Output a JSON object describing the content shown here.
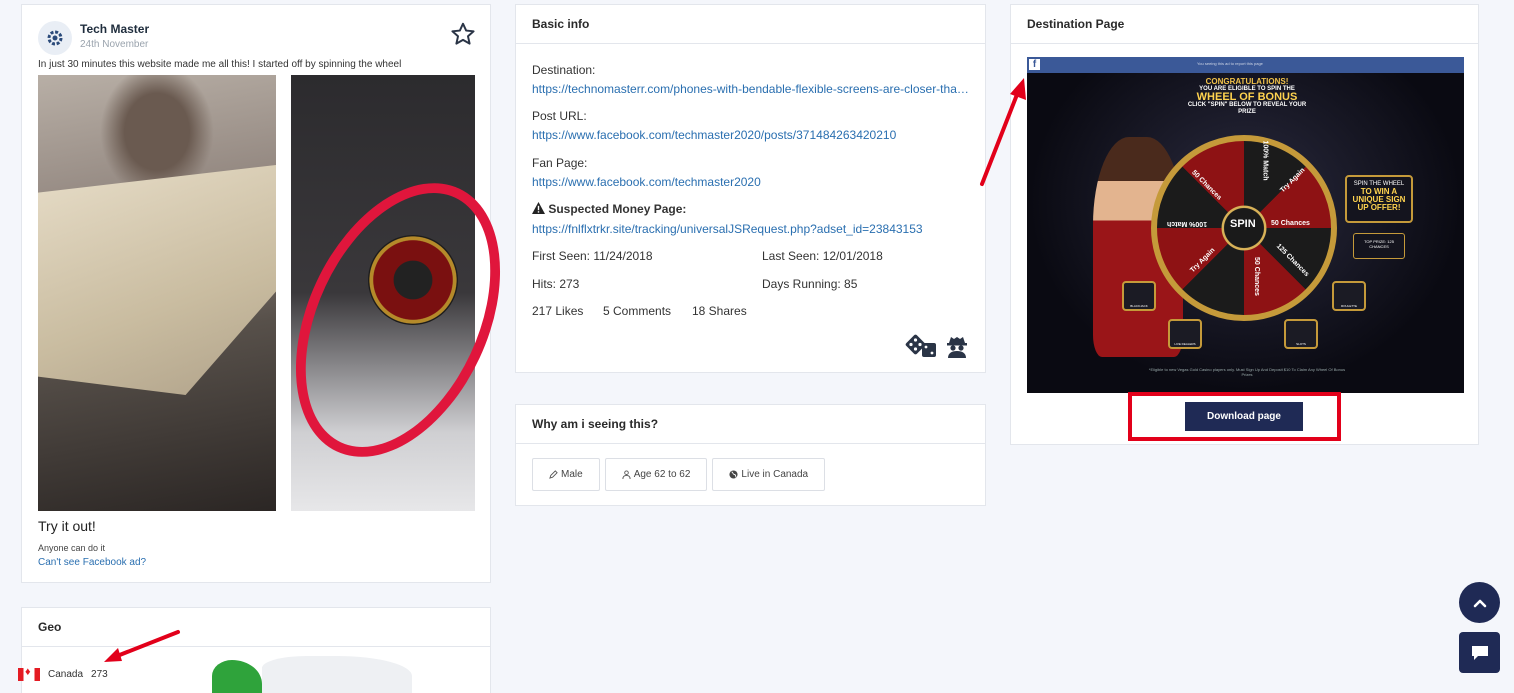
{
  "ad": {
    "page_name": "Tech Master",
    "post_date": "24th November",
    "text": "In just 30 minutes this website made me all this! I started off by spinning the wheel",
    "cta_title": "Try it out!",
    "cta_subtitle": "Anyone can do it",
    "cant_see_link": "Can't see Facebook ad?"
  },
  "geo": {
    "title": "Geo",
    "country": "Canada",
    "count": "273"
  },
  "basic_info": {
    "title": "Basic info",
    "destination_label": "Destination:",
    "destination_url": "https://technomasterr.com/phones-with-bendable-flexible-screens-are-closer-than-you-think/",
    "post_url_label": "Post URL:",
    "post_url": "https://www.facebook.com/techmaster2020/posts/371484263420210",
    "fan_page_label": "Fan Page:",
    "fan_page_url": "https://www.facebook.com/techmaster2020",
    "money_page_label": "Suspected Money Page:",
    "money_page_url": "https://fnlflxtrkr.site/tracking/universalJSRequest.php?adset_id=23843153",
    "first_seen": "First Seen: 11/24/2018",
    "last_seen": "Last Seen: 12/01/2018",
    "hits": "Hits: 273",
    "days_running": "Days Running: 85",
    "likes": "217 Likes",
    "comments": "5 Comments",
    "shares": "18 Shares"
  },
  "why": {
    "title": "Why am i seeing this?",
    "gender": "Male",
    "age": "Age 62 to 62",
    "location": "Live in Canada"
  },
  "destination_page": {
    "title": "Destination Page",
    "fb_note": "You seeing this ad to report this page",
    "headline_top": "CONGRATULATIONS!",
    "headline_mid": "YOU ARE ELIGIBLE TO SPIN THE",
    "headline_big": "WHEEL OF BONUS",
    "headline_sub": "CLICK \"SPIN\" BELOW TO REVEAL YOUR PRIZE",
    "wheel_center": "SPIN",
    "wheel_labels": [
      "100% Match",
      "Try Again",
      "50 Chances",
      "125 Chances",
      "50 Chances",
      "Try Again",
      "100% Match",
      "50 Chances"
    ],
    "promo_top": "SPIN THE WHEEL",
    "promo_main": "TO WIN A UNIQUE SIGN UP OFFER!",
    "prize": "TOP PRIZE: 125 CHANCES",
    "game_buttons": [
      "BLACKJACK",
      "LIVE DEALERS",
      "SLOTS",
      "ROULETTE"
    ],
    "fine_print": "*Eligible to new Vegas Gold Casino players only. Must Sign Up And Deposit $10 To Claim Any Wheel Of Bonus Prizes",
    "download_label": "Download page"
  },
  "colors": {
    "link": "#2a6fb0",
    "dark_button": "#1f2a55",
    "highlight_red": "#e2001a",
    "facebook_blue": "#3b5998"
  },
  "icons": [
    "settings-icon",
    "star-icon",
    "warning-icon",
    "dice-icon",
    "spy-icon",
    "pencil-icon",
    "user-icon",
    "globe-icon",
    "chevron-up-icon",
    "chat-icon"
  ]
}
